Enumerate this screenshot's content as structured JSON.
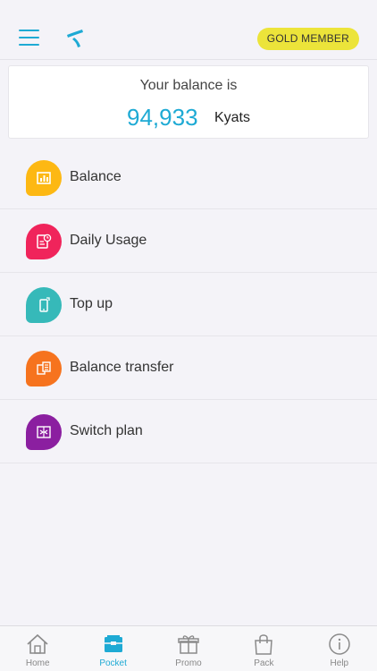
{
  "header": {
    "badge": "GOLD MEMBER",
    "accent_color": "#1eaad4",
    "badge_color": "#ece43a"
  },
  "balance_card": {
    "title": "Your balance is",
    "amount": "94,933",
    "currency": "Kyats"
  },
  "menu": {
    "items": [
      {
        "label": "Balance",
        "icon": "balance-icon",
        "color": "#fdb813"
      },
      {
        "label": "Daily Usage",
        "icon": "daily-usage-icon",
        "color": "#f0245b"
      },
      {
        "label": "Top up",
        "icon": "top-up-phone-icon",
        "color": "#36b9b9"
      },
      {
        "label": "Balance transfer",
        "icon": "balance-transfer-icon",
        "color": "#f6731e"
      },
      {
        "label": "Switch plan",
        "icon": "switch-plan-icon",
        "color": "#8b1fa0"
      }
    ]
  },
  "tabbar": {
    "items": [
      {
        "label": "Home",
        "icon": "home-icon",
        "active": false
      },
      {
        "label": "Pocket",
        "icon": "pocket-icon",
        "active": true
      },
      {
        "label": "Promo",
        "icon": "gift-icon",
        "active": false
      },
      {
        "label": "Pack",
        "icon": "shopping-bag-icon",
        "active": false
      },
      {
        "label": "Help",
        "icon": "info-icon",
        "active": false
      }
    ]
  }
}
